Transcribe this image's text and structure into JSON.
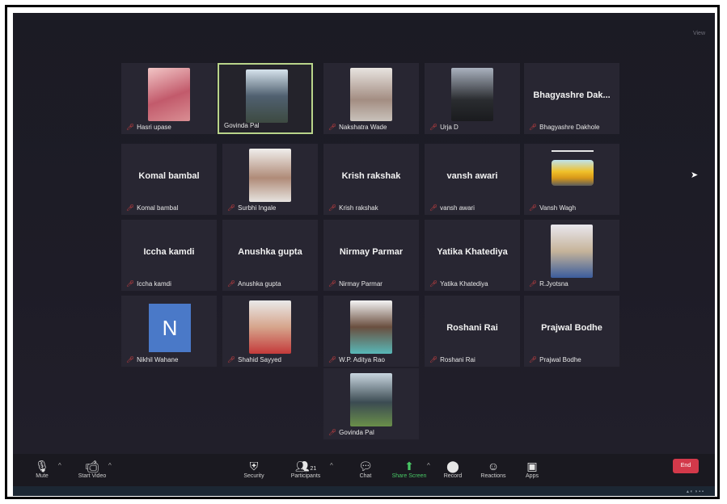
{
  "window": {
    "corner_label": "View"
  },
  "participants": [
    {
      "name": "Hasri upase",
      "video": true
    },
    {
      "name": "Govinda Pal",
      "video": true,
      "active_speaker": true
    },
    {
      "name": "Nakshatra Wade",
      "video": true
    },
    {
      "name": "Urja D",
      "video": true
    },
    {
      "name": "Bhagyashre Dakhole",
      "display": "Bhagyashre Dak..."
    },
    {
      "name": "Komal bambal",
      "display": "Komal bambal"
    },
    {
      "name": "Surbhi Ingale",
      "video": true
    },
    {
      "name": "Krish  rakshak",
      "display": "Krish  rakshak"
    },
    {
      "name": "vansh awari",
      "display": "vansh awari"
    },
    {
      "name": "Vansh Wagh",
      "video": true
    },
    {
      "name": "Iccha kamdi",
      "display": "Iccha kamdi"
    },
    {
      "name": "Anushka gupta",
      "display": "Anushka gupta"
    },
    {
      "name": "Nirmay Parmar",
      "display": "Nirmay Parmar"
    },
    {
      "name": "Yatika Khatediya",
      "display": "Yatika Khatediya"
    },
    {
      "name": "R.Jyotsna",
      "video": true
    },
    {
      "name": "Nikhil Wahane",
      "avatar_letter": "N"
    },
    {
      "name": "Shahid Sayyed",
      "video": true
    },
    {
      "name": "W.P. Aditya Rao",
      "video": true
    },
    {
      "name": "Roshani Rai",
      "display": "Roshani Rai"
    },
    {
      "name": "Prajwal  Bodhe",
      "display": "Prajwal  Bodhe"
    },
    {
      "name": "Govinda Pal",
      "video": true
    }
  ],
  "toolbar": {
    "mute": "Mute",
    "start_video": "Start Video",
    "security": "Security",
    "participants": "Participants",
    "participant_count": "21",
    "chat": "Chat",
    "share_screen": "Share Screen",
    "record": "Record",
    "reactions": "Reactions",
    "apps": "Apps",
    "end": "End"
  },
  "icons": {
    "mic": "microphone-icon",
    "video": "video-camera-icon",
    "security": "shield-icon",
    "participants": "people-icon",
    "chat": "chat-bubble-icon",
    "share": "share-screen-icon",
    "record": "record-icon",
    "reactions": "emoji-icon",
    "apps": "apps-icon",
    "muted": "muted-mic-icon"
  },
  "colors": {
    "accent_green": "#48c765",
    "end_red": "#d3394a",
    "active_border": "#b9d48a",
    "tile_bg": "#282632"
  }
}
